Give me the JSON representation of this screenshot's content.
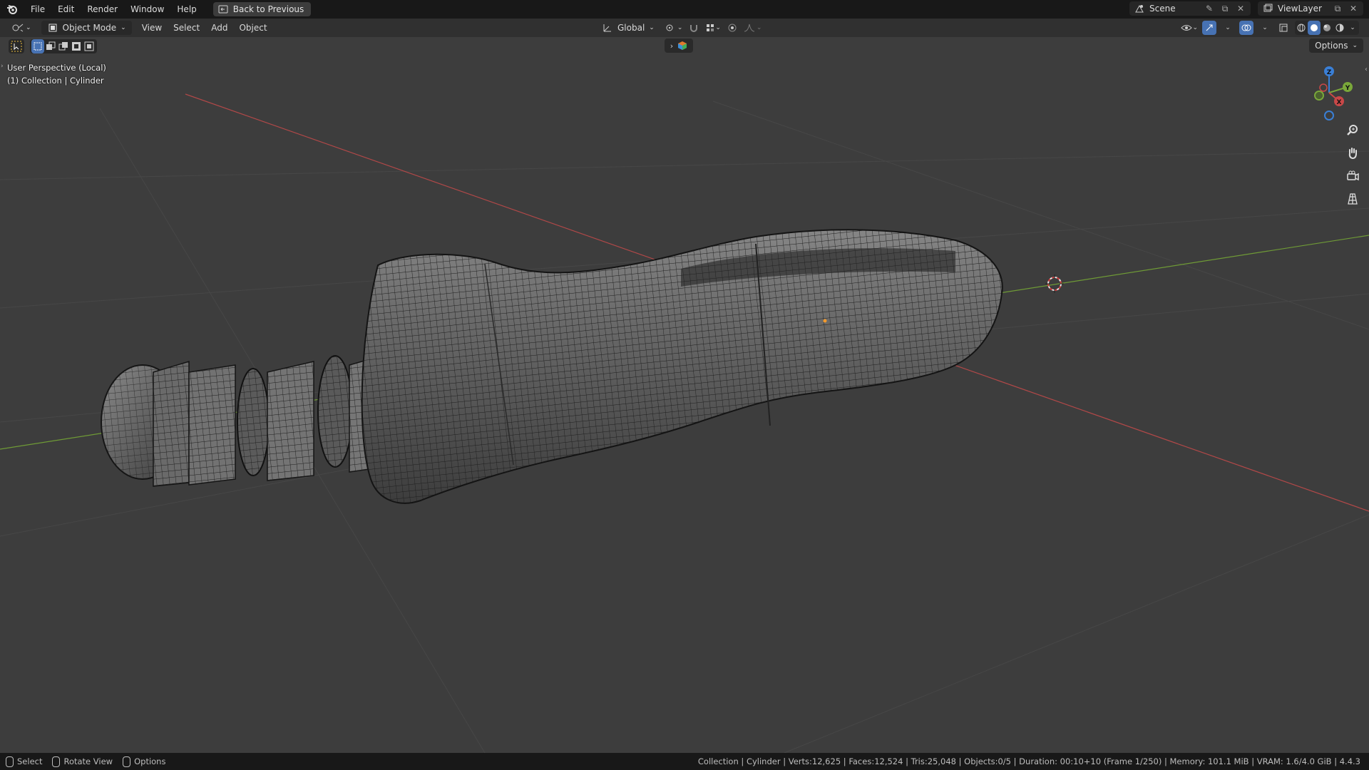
{
  "topbar": {
    "menus": [
      "File",
      "Edit",
      "Render",
      "Window",
      "Help"
    ],
    "back_button": "Back to Previous",
    "scene_name": "Scene",
    "view_layer_name": "ViewLayer"
  },
  "header": {
    "mode": "Object Mode",
    "menus": [
      "View",
      "Select",
      "Add",
      "Object"
    ],
    "transform_orientation": "Global"
  },
  "viewport": {
    "overlay_line1": "User Perspective (Local)",
    "overlay_line2": "(1) Collection | Cylinder",
    "options_label": "Options",
    "gizmo_labels": {
      "z": "Z",
      "y": "Y",
      "x": "X"
    }
  },
  "statusbar": {
    "items": [
      "Select",
      "Rotate View",
      "Options"
    ],
    "info": "Collection | Cylinder | Verts:12,625 | Faces:12,524 | Tris:25,048 | Objects:0/5 | Duration: 00:10+10 (Frame 1/250) | Memory: 101.1 MiB | VRAM: 1.6/4.0 GiB | 4.4.3"
  },
  "colors": {
    "accent": "#4772b3",
    "viewport_bg": "#3d3d3d",
    "x_axis": "#c94848",
    "y_axis": "#7aa83a",
    "z_axis": "#3a7fd6"
  }
}
